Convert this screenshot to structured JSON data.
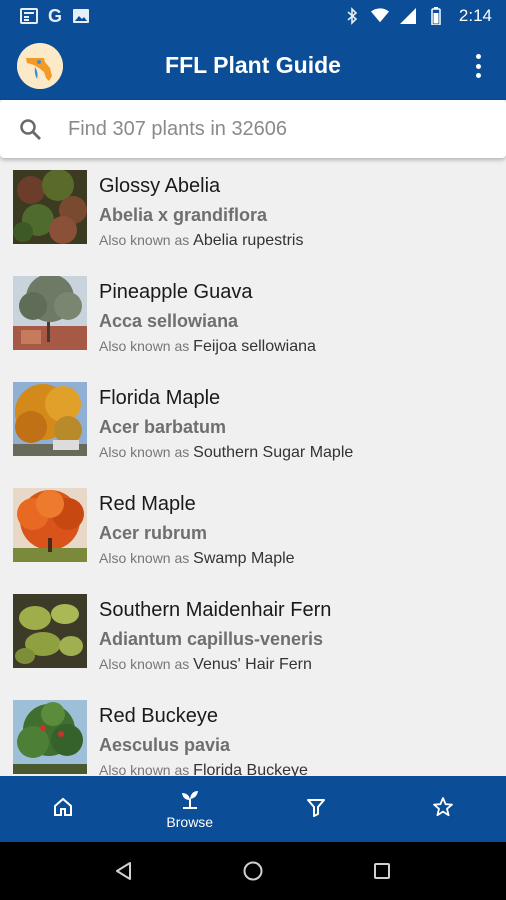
{
  "status_bar": {
    "time": "2:14",
    "left_icons": [
      "news-icon",
      "google-icon",
      "image-icon"
    ],
    "right_icons": [
      "bluetooth-icon",
      "wifi-icon",
      "signal-icon",
      "battery-icon"
    ]
  },
  "app_bar": {
    "title": "FFL Plant Guide",
    "logo": "florida-logo",
    "menu_icon": "more-vert-icon"
  },
  "search": {
    "placeholder": "Find 307 plants in 32606",
    "value": ""
  },
  "plants": [
    {
      "common": "Glossy Abelia",
      "scientific": "Abelia x grandiflora",
      "aka_prefix": "Also known as",
      "aka": "Abelia rupestris"
    },
    {
      "common": "Pineapple Guava",
      "scientific": "Acca sellowiana",
      "aka_prefix": "Also known as",
      "aka": "Feijoa sellowiana"
    },
    {
      "common": "Florida Maple",
      "scientific": "Acer barbatum",
      "aka_prefix": "Also known as",
      "aka": "Southern Sugar Maple"
    },
    {
      "common": "Red Maple",
      "scientific": "Acer rubrum",
      "aka_prefix": "Also known as",
      "aka": "Swamp Maple"
    },
    {
      "common": "Southern Maidenhair Fern",
      "scientific": "Adiantum capillus-veneris",
      "aka_prefix": "Also known as",
      "aka": "Venus' Hair Fern"
    },
    {
      "common": "Red Buckeye",
      "scientific": "Aesculus pavia",
      "aka_prefix": "Also known as",
      "aka": "Florida Buckeye"
    }
  ],
  "bottom_nav": {
    "tabs": [
      {
        "icon": "home-icon",
        "label": ""
      },
      {
        "icon": "sprout-icon",
        "label": "Browse"
      },
      {
        "icon": "filter-icon",
        "label": ""
      },
      {
        "icon": "star-icon",
        "label": ""
      }
    ],
    "active_index": 1
  },
  "system_nav": [
    "back-icon",
    "home-circle-icon",
    "recents-icon"
  ],
  "colors": {
    "primary": "#0b4d96",
    "background": "#f0f0f0",
    "scientific_text": "#6f6f6f"
  }
}
